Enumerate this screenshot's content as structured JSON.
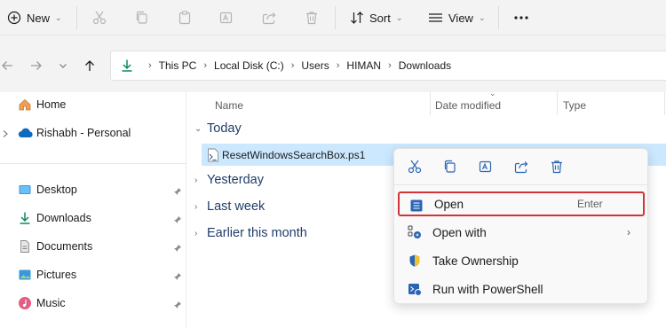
{
  "toolbar": {
    "new_label": "New",
    "sort_label": "Sort",
    "view_label": "View"
  },
  "breadcrumb": [
    "This PC",
    "Local Disk (C:)",
    "Users",
    "HIMAN",
    "Downloads"
  ],
  "nav": {
    "home": "Home",
    "onedrive": "Rishabh - Personal",
    "quick": [
      "Desktop",
      "Downloads",
      "Documents",
      "Pictures",
      "Music"
    ]
  },
  "columns": {
    "name": "Name",
    "date_modified": "Date modified",
    "type": "Type"
  },
  "groups": {
    "today": "Today",
    "yesterday": "Yesterday",
    "last_week": "Last week",
    "earlier": "Earlier this month"
  },
  "file": {
    "name": "ResetWindowsSearchBox.ps1"
  },
  "context_menu": {
    "open_label": "Open",
    "open_shortcut": "Enter",
    "open_with_label": "Open with",
    "take_ownership_label": "Take Ownership",
    "run_powershell_label": "Run with PowerShell"
  },
  "colors": {
    "accent": "#0067c0",
    "selection": "#cce8ff",
    "highlight_border": "#d13438",
    "group_text": "#1f3d6b"
  }
}
